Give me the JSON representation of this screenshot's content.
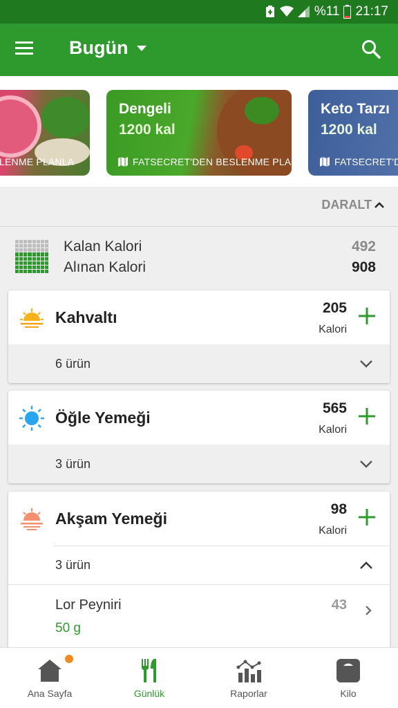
{
  "status_bar": {
    "battery_percent": "%11",
    "time": "21:17"
  },
  "app_bar": {
    "title": "Bugün",
    "menu_icon": "hamburger-icon",
    "search_icon": "search-icon",
    "dropdown_icon": "caret-down-icon"
  },
  "plans": [
    {
      "title": "",
      "kcal": "",
      "footer": "N BESLENME PLANLA"
    },
    {
      "title": "Dengeli",
      "kcal": "1200 kal",
      "footer": "FATSECRET'DEN BESLENME PLANLA"
    },
    {
      "title": "Keto Tarzı",
      "kcal": "1200 kal",
      "footer": "FATSECRET'DE"
    }
  ],
  "collapse": {
    "label": "DARALT"
  },
  "summary": {
    "remaining_label": "Kalan Kalori",
    "remaining_value": "492",
    "consumed_label": "Alınan Kalori",
    "consumed_value": "908"
  },
  "meals": [
    {
      "name": "Kahvaltı",
      "calories": "205",
      "unit": "Kalori",
      "items_count": "6 ürün",
      "icon": "sunrise-icon"
    },
    {
      "name": "Öğle Yemeği",
      "calories": "565",
      "unit": "Kalori",
      "items_count": "3 ürün",
      "icon": "sun-icon"
    },
    {
      "name": "Akşam Yemeği",
      "calories": "98",
      "unit": "Kalori",
      "items_count": "3 ürün",
      "icon": "sunset-icon",
      "items": [
        {
          "name": "Lor Peyniri",
          "qty": "50  g",
          "calories": "43"
        }
      ]
    }
  ],
  "bottom_nav": [
    {
      "label": "Ana Sayfa",
      "icon": "home-icon"
    },
    {
      "label": "Günlük",
      "icon": "fork-knife-icon"
    },
    {
      "label": "Raporlar",
      "icon": "chart-icon"
    },
    {
      "label": "Kilo",
      "icon": "scale-icon"
    }
  ],
  "colors": {
    "primary": "#2e9a2e",
    "status_bar": "#1f7a1f",
    "badge": "#f08a1c"
  }
}
